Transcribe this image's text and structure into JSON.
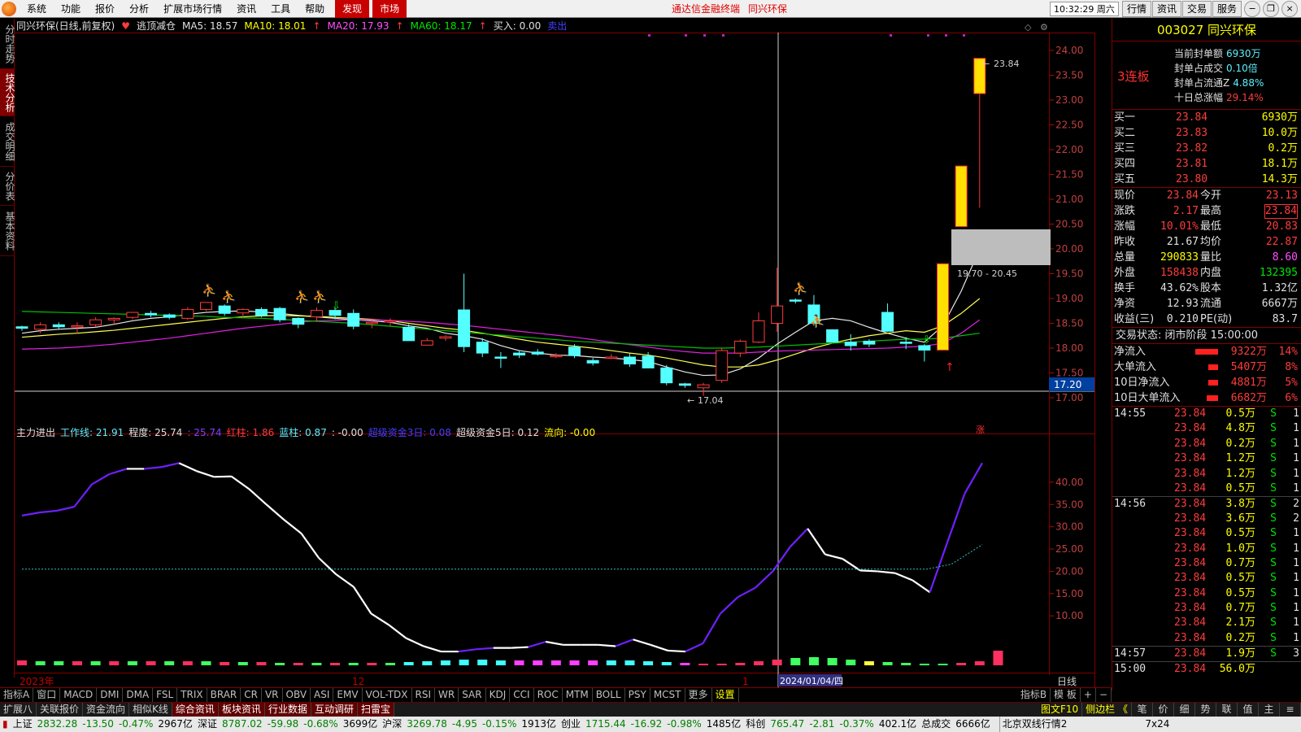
{
  "menu": {
    "items": [
      "系统",
      "功能",
      "报价",
      "分析",
      "扩展市场行情",
      "资讯",
      "工具",
      "帮助"
    ],
    "discover": "发现",
    "market": "市场",
    "center_links": [
      "通达信金融终端",
      "同兴环保"
    ],
    "clock": "10:32:29 周六",
    "right_buttons": [
      "行情",
      "资讯",
      "交易",
      "服务"
    ]
  },
  "left_tabs": [
    "分时走势",
    "技术分析",
    "成交明细",
    "分价表",
    "基本资料"
  ],
  "chart_header": {
    "title": "同兴环保(日线,前复权)",
    "indicator_name": "逃顶减仓",
    "ma5": "MA5: 18.57",
    "ma10": "MA10: 18.01",
    "ma20": "MA20: 17.93",
    "ma60": "MA60: 18.17",
    "buy": "买入: 0.00",
    "sell": "卖出"
  },
  "sub_header": {
    "name": "主力进出",
    "work_line": "工作线: 21.91",
    "degree": "程度: 25.74",
    "degree2": ": 25.74",
    "red_col": "红柱: 1.86",
    "blue_col": "蓝柱: 0.87",
    "val": ": -0.00",
    "super3": "超级资金3日: 0.08",
    "super5": "超级资金5日: 0.12",
    "flow": "流向: -0.00"
  },
  "price_axis_labels": [
    "24.00",
    "23.50",
    "23.00",
    "22.50",
    "22.00",
    "21.50",
    "21.00",
    "20.50",
    "20.00",
    "19.50",
    "19.00",
    "18.50",
    "18.00",
    "17.50",
    "17.00"
  ],
  "sub_axis_labels": [
    "40.00",
    "35.00",
    "30.00",
    "25.00",
    "20.00",
    "15.00",
    "10.00"
  ],
  "crosshair_price": "17.20",
  "annotations": {
    "high": "23.84",
    "low": "17.04",
    "gap": "19.70 - 20.45",
    "zhang": "涨"
  },
  "date_axis": {
    "year": "2023年",
    "m12": "12",
    "m1": "1",
    "cursor_date": "2024/01/04/四",
    "period": "日线"
  },
  "chart_data": {
    "type": "candlestick",
    "ohlc": [
      [
        18.43,
        18.45,
        18.35,
        18.4
      ],
      [
        18.38,
        18.52,
        18.3,
        18.47
      ],
      [
        18.47,
        18.52,
        18.38,
        18.43
      ],
      [
        18.44,
        18.52,
        18.3,
        18.45
      ],
      [
        18.47,
        18.62,
        18.42,
        18.57
      ],
      [
        18.57,
        18.62,
        18.48,
        18.6
      ],
      [
        18.62,
        18.73,
        18.58,
        18.72
      ],
      [
        18.7,
        18.75,
        18.62,
        18.67
      ],
      [
        18.67,
        18.7,
        18.58,
        18.62
      ],
      [
        18.6,
        18.82,
        18.57,
        18.78
      ],
      [
        18.78,
        18.92,
        18.75,
        18.92
      ],
      [
        18.85,
        18.88,
        18.65,
        18.7
      ],
      [
        18.71,
        18.8,
        18.62,
        18.78
      ],
      [
        18.78,
        18.82,
        18.62,
        18.66
      ],
      [
        18.8,
        18.83,
        18.52,
        18.57
      ],
      [
        18.6,
        18.62,
        18.4,
        18.48
      ],
      [
        18.63,
        18.82,
        18.53,
        18.76
      ],
      [
        18.76,
        18.82,
        18.58,
        18.66
      ],
      [
        18.7,
        18.78,
        18.38,
        18.44
      ],
      [
        18.5,
        18.58,
        18.4,
        18.52
      ],
      [
        18.54,
        18.6,
        18.45,
        18.55
      ],
      [
        18.42,
        18.48,
        18.15,
        18.15
      ],
      [
        18.06,
        18.2,
        18.05,
        18.15
      ],
      [
        18.2,
        18.26,
        18.15,
        18.23
      ],
      [
        18.77,
        19.5,
        17.92,
        18.03
      ],
      [
        18.12,
        18.2,
        17.82,
        17.9
      ],
      [
        17.82,
        17.92,
        17.6,
        17.8
      ],
      [
        17.9,
        17.96,
        17.8,
        17.86
      ],
      [
        17.92,
        17.98,
        17.85,
        17.88
      ],
      [
        17.85,
        17.9,
        17.8,
        17.85
      ],
      [
        18.02,
        18.08,
        17.8,
        17.85
      ],
      [
        17.75,
        17.8,
        17.65,
        17.7
      ],
      [
        17.8,
        17.88,
        17.78,
        17.82
      ],
      [
        17.82,
        17.9,
        17.62,
        17.68
      ],
      [
        17.84,
        17.92,
        17.7,
        17.6
      ],
      [
        17.6,
        17.66,
        17.25,
        17.3
      ],
      [
        17.28,
        17.3,
        17.2,
        17.25
      ],
      [
        17.2,
        17.3,
        17.04,
        17.26
      ],
      [
        17.35,
        18.0,
        17.3,
        17.95
      ],
      [
        17.9,
        18.17,
        17.82,
        18.14
      ],
      [
        18.12,
        18.72,
        18.1,
        18.55
      ],
      [
        18.5,
        19.62,
        18.33,
        18.85
      ],
      [
        18.97,
        19.0,
        18.9,
        18.95
      ],
      [
        18.87,
        19.07,
        18.45,
        18.5
      ],
      [
        18.37,
        18.38,
        18.12,
        18.12
      ],
      [
        18.12,
        18.28,
        17.95,
        18.05
      ],
      [
        18.14,
        18.18,
        18.02,
        18.08
      ],
      [
        18.72,
        18.9,
        18.33,
        18.34
      ],
      [
        18.12,
        18.22,
        17.98,
        18.1
      ],
      [
        18.05,
        18.08,
        17.73,
        17.96
      ],
      [
        17.96,
        19.7,
        17.96,
        19.7
      ],
      [
        20.45,
        21.67,
        20.45,
        21.67
      ],
      [
        23.13,
        23.84,
        20.83,
        23.84
      ]
    ],
    "ma_series": [
      {
        "name": "MA5",
        "color": "#e8e8e8",
        "values": [
          18.3,
          18.35,
          18.38,
          18.4,
          18.42,
          18.48,
          18.55,
          18.6,
          18.63,
          18.68,
          18.72,
          18.74,
          18.75,
          18.73,
          18.7,
          18.66,
          18.63,
          18.6,
          18.57,
          18.55,
          18.52,
          18.45,
          18.4,
          18.3,
          18.25,
          18.18,
          18.05,
          17.95,
          17.9,
          17.86,
          17.85,
          17.82,
          17.8,
          17.77,
          17.73,
          17.62,
          17.52,
          17.45,
          17.46,
          17.58,
          17.8,
          18.08,
          18.32,
          18.55,
          18.6,
          18.55,
          18.42,
          18.3,
          18.2,
          18.12,
          18.45,
          19.15,
          20.0
        ]
      },
      {
        "name": "MA10",
        "color": "#ffff50",
        "values": [
          18.22,
          18.25,
          18.28,
          18.3,
          18.33,
          18.36,
          18.4,
          18.44,
          18.48,
          18.52,
          18.56,
          18.6,
          18.63,
          18.65,
          18.66,
          18.65,
          18.64,
          18.62,
          18.6,
          18.58,
          18.55,
          18.5,
          18.45,
          18.4,
          18.36,
          18.3,
          18.24,
          18.18,
          18.12,
          18.08,
          18.04,
          18.0,
          17.95,
          17.9,
          17.86,
          17.8,
          17.73,
          17.66,
          17.62,
          17.62,
          17.66,
          17.76,
          17.88,
          18.0,
          18.1,
          18.18,
          18.25,
          18.3,
          18.35,
          18.32,
          18.45,
          18.7,
          19.0
        ]
      },
      {
        "name": "MA20",
        "color": "#e020e0",
        "values": [
          17.98,
          17.99,
          18.0,
          18.02,
          18.05,
          18.08,
          18.12,
          18.16,
          18.2,
          18.25,
          18.3,
          18.35,
          18.4,
          18.44,
          18.48,
          18.52,
          18.55,
          18.56,
          18.57,
          18.57,
          18.56,
          18.54,
          18.52,
          18.49,
          18.46,
          18.42,
          18.38,
          18.34,
          18.3,
          18.26,
          18.22,
          18.17,
          18.12,
          18.07,
          18.02,
          17.97,
          17.93,
          17.9,
          17.9,
          17.9,
          17.92,
          17.94,
          17.95,
          17.96,
          17.97,
          17.98,
          17.99,
          18.0,
          18.02,
          18.04,
          18.1,
          18.3,
          18.57
        ]
      },
      {
        "name": "MA60",
        "color": "#00c000",
        "values": [
          18.74,
          18.73,
          18.72,
          18.71,
          18.7,
          18.69,
          18.68,
          18.67,
          18.66,
          18.65,
          18.64,
          18.62,
          18.61,
          18.6,
          18.58,
          18.56,
          18.54,
          18.52,
          18.5,
          18.47,
          18.44,
          18.41,
          18.38,
          18.35,
          18.32,
          18.29,
          18.26,
          18.23,
          18.2,
          18.17,
          18.14,
          18.12,
          18.1,
          18.08,
          18.06,
          18.04,
          18.02,
          18.0,
          18.0,
          18.01,
          18.02,
          18.04,
          18.06,
          18.08,
          18.1,
          18.12,
          18.14,
          18.16,
          18.18,
          18.18,
          18.2,
          18.25,
          18.3
        ]
      }
    ],
    "sub_line": [
      32.5,
      33.2,
      33.6,
      34.5,
      39.5,
      41.8,
      43,
      43,
      43.4,
      44.3,
      42.5,
      41.2,
      41.3,
      38.5,
      35,
      31.6,
      28.5,
      23,
      19.3,
      16.5,
      10.5,
      8,
      5,
      3.2,
      2,
      2,
      2.5,
      2.8,
      2.8,
      3,
      4.2,
      3.5,
      3.5,
      3.5,
      3.2,
      4.7,
      3.5,
      2.2,
      2,
      3.8,
      10.5,
      14.2,
      16.3,
      20,
      25.5,
      29.6,
      23.8,
      22.8,
      20.2,
      20,
      19.6,
      18,
      15.3,
      26.5,
      37.5,
      44.3
    ],
    "sub_dashed": 20.5,
    "price_ylim": [
      16.8,
      24.2
    ],
    "sub_ylim": [
      0,
      46
    ]
  },
  "quote": {
    "code_name": "003027 同兴环保",
    "lianban": "3连板",
    "seal_info": [
      {
        "label": "当前封单额",
        "value": "6930万"
      },
      {
        "label": "封单占成交",
        "value": "0.10倍"
      },
      {
        "label": "封单占流通Z",
        "value": "4.88%"
      },
      {
        "label": "十日总涨幅",
        "value": "29.14%"
      }
    ],
    "bids": [
      {
        "label": "买一",
        "price": "23.84",
        "vol": "6930万"
      },
      {
        "label": "买二",
        "price": "23.83",
        "vol": "10.0万"
      },
      {
        "label": "买三",
        "price": "23.82",
        "vol": "0.2万"
      },
      {
        "label": "买四",
        "price": "23.81",
        "vol": "18.1万"
      },
      {
        "label": "买五",
        "price": "23.80",
        "vol": "14.3万"
      }
    ],
    "stats": [
      {
        "l1": "现价",
        "v1": "23.84",
        "l2": "今开",
        "v2": "23.13",
        "c1": "red",
        "c2": "red"
      },
      {
        "l1": "涨跌",
        "v1": "2.17",
        "l2": "最高",
        "v2": "23.84",
        "c1": "red",
        "c2": "red"
      },
      {
        "l1": "涨幅",
        "v1": "10.01%",
        "l2": "最低",
        "v2": "20.83",
        "c1": "red",
        "c2": "red"
      },
      {
        "l1": "昨收",
        "v1": "21.67",
        "l2": "均价",
        "v2": "22.87",
        "c1": "white",
        "c2": "red"
      },
      {
        "l1": "总量",
        "v1": "290833",
        "l2": "量比",
        "v2": "8.60",
        "c1": "yellow",
        "c2": "magenta"
      },
      {
        "l1": "外盘",
        "v1": "158438",
        "l2": "内盘",
        "v2": "132395",
        "c1": "red",
        "c2": "green"
      },
      {
        "l1": "换手",
        "v1": "43.62%",
        "l2": "股本",
        "v2": "1.32亿",
        "c1": "white",
        "c2": "white"
      },
      {
        "l1": "净资",
        "v1": "12.93",
        "l2": "流通",
        "v2": "6667万",
        "c1": "white",
        "c2": "white"
      },
      {
        "l1": "收益(三)",
        "v1": "0.210",
        "l2": "PE(动)",
        "v2": "83.7",
        "c1": "white",
        "c2": "white"
      }
    ],
    "trade_status": "交易状态: 闭市阶段 15:00:00",
    "flows": [
      {
        "label": "净流入",
        "value": "9322万",
        "pct": "14%",
        "bar": 28
      },
      {
        "label": "大单流入",
        "value": "5407万",
        "pct": "8%",
        "bar": 12
      },
      {
        "label": "10日净流入",
        "value": "4881万",
        "pct": "5%",
        "bar": 12
      },
      {
        "label": "10日大单流入",
        "value": "6682万",
        "pct": "6%",
        "bar": 14
      }
    ],
    "ticks": [
      {
        "time": "14:55",
        "price": "23.84",
        "vol": "0.5万",
        "side": "S",
        "n": "1"
      },
      {
        "time": "",
        "price": "23.84",
        "vol": "4.8万",
        "side": "S",
        "n": "1"
      },
      {
        "time": "",
        "price": "23.84",
        "vol": "0.2万",
        "side": "S",
        "n": "1"
      },
      {
        "time": "",
        "price": "23.84",
        "vol": "1.2万",
        "side": "S",
        "n": "1"
      },
      {
        "time": "",
        "price": "23.84",
        "vol": "1.2万",
        "side": "S",
        "n": "1"
      },
      {
        "time": "",
        "price": "23.84",
        "vol": "0.5万",
        "side": "S",
        "n": "1"
      },
      {
        "time": "14:56",
        "price": "23.84",
        "vol": "3.8万",
        "side": "S",
        "n": "2"
      },
      {
        "time": "",
        "price": "23.84",
        "vol": "3.6万",
        "side": "S",
        "n": "2"
      },
      {
        "time": "",
        "price": "23.84",
        "vol": "0.5万",
        "side": "S",
        "n": "1"
      },
      {
        "time": "",
        "price": "23.84",
        "vol": "1.0万",
        "side": "S",
        "n": "1"
      },
      {
        "time": "",
        "price": "23.84",
        "vol": "0.7万",
        "side": "S",
        "n": "1"
      },
      {
        "time": "",
        "price": "23.84",
        "vol": "0.5万",
        "side": "S",
        "n": "1"
      },
      {
        "time": "",
        "price": "23.84",
        "vol": "0.5万",
        "side": "S",
        "n": "1"
      },
      {
        "time": "",
        "price": "23.84",
        "vol": "0.7万",
        "side": "S",
        "n": "1"
      },
      {
        "time": "",
        "price": "23.84",
        "vol": "2.1万",
        "side": "S",
        "n": "1"
      },
      {
        "time": "",
        "price": "23.84",
        "vol": "0.2万",
        "side": "S",
        "n": "1"
      },
      {
        "time": "14:57",
        "price": "23.84",
        "vol": "1.9万",
        "side": "S",
        "n": "3"
      },
      {
        "time": "15:00",
        "price": "23.84",
        "vol": "56.0万",
        "side": "",
        "n": ""
      }
    ]
  },
  "indicator_tabs": [
    "指标A",
    "窗口",
    "MACD",
    "DMI",
    "DMA",
    "FSL",
    "TRIX",
    "BRAR",
    "CR",
    "VR",
    "OBV",
    "ASI",
    "EMV",
    "VOL-TDX",
    "RSI",
    "WR",
    "SAR",
    "KDJ",
    "CCI",
    "ROC",
    "MTM",
    "BOLL",
    "PSY",
    "MCST",
    "更多",
    "设置"
  ],
  "indicator_right": [
    "指标B",
    "模 板",
    "+",
    "−"
  ],
  "func_tabs": [
    "扩展八",
    "关联报价",
    "资金流向",
    "相似K线",
    "综合资讯",
    "板块资讯",
    "行业数据",
    "互动调研",
    "扫雷宝"
  ],
  "func_right": [
    "图文F10",
    "侧边栏 《",
    "笔",
    "价",
    "细",
    "势",
    "联",
    "值",
    "主",
    "≡"
  ],
  "status": [
    {
      "name": "上证",
      "p": "2832.28",
      "c": "-13.50",
      "pct": "-0.47%",
      "amt": "2967亿"
    },
    {
      "name": "深证",
      "p": "8787.02",
      "c": "-59.98",
      "pct": "-0.68%",
      "amt": "3699亿"
    },
    {
      "name": "沪深",
      "p": "3269.78",
      "c": "-4.95",
      "pct": "-0.15%",
      "amt": "1913亿"
    },
    {
      "name": "创业",
      "p": "1715.44",
      "c": "-16.92",
      "pct": "-0.98%",
      "amt": "1485亿"
    },
    {
      "name": "科创",
      "p": "765.47",
      "c": "-2.81",
      "pct": "-0.37%",
      "amt": "402.1亿"
    }
  ],
  "status_total": "总成交",
  "status_total_val": "6666亿",
  "status_right": "北京双线行情2",
  "status_time": "7x24"
}
